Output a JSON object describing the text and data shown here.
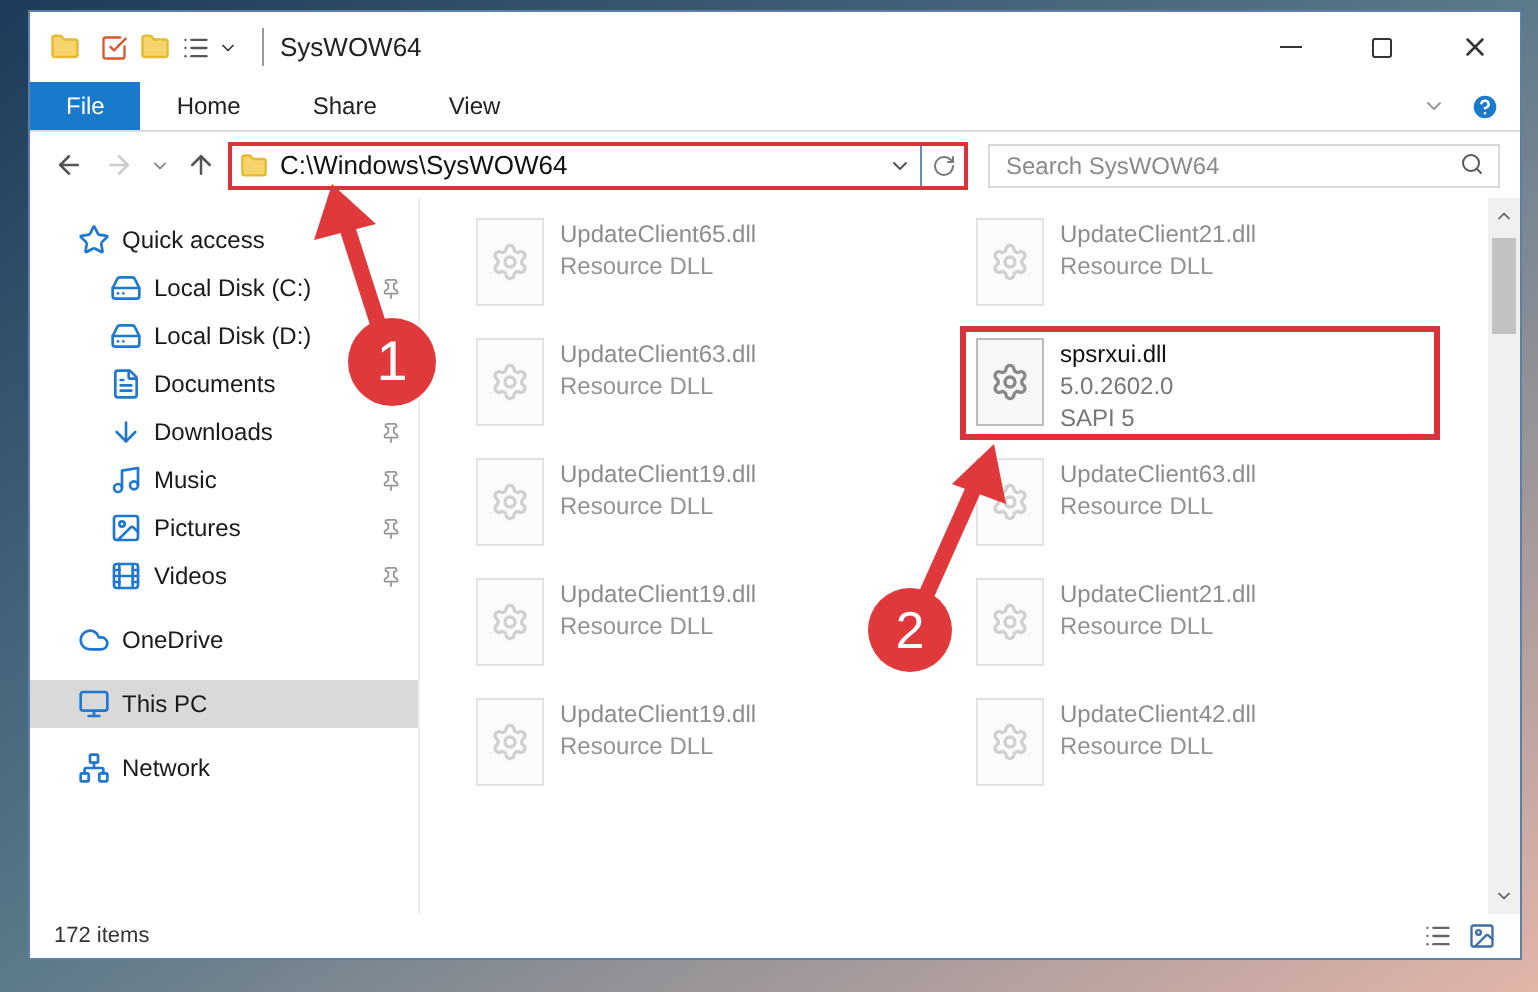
{
  "window": {
    "title": "SysWOW64"
  },
  "ribbon_tabs": [
    {
      "label": "File",
      "kind": "file",
      "selected": false
    },
    {
      "label": "Home",
      "kind": "tab",
      "selected": false
    },
    {
      "label": "Share",
      "kind": "tab",
      "selected": false
    },
    {
      "label": "View",
      "kind": "tab",
      "selected": false
    }
  ],
  "address": {
    "value": "C:\\Windows\\SysWOW64"
  },
  "search": {
    "placeholder": "Search SysWOW64"
  },
  "nav": [
    {
      "label": "Quick access",
      "selected": false,
      "children": [
        {
          "label": "Local Disk (C:)",
          "pinned": true,
          "selected": false
        },
        {
          "label": "Local Disk (D:)",
          "selected": false
        },
        {
          "label": "Documents",
          "selected": false
        },
        {
          "label": "Downloads",
          "pinned": true,
          "selected": false
        },
        {
          "label": "Music",
          "pinned": true,
          "selected": false
        },
        {
          "label": "Pictures",
          "pinned": true,
          "selected": false
        },
        {
          "label": "Videos",
          "pinned": true,
          "selected": false
        }
      ]
    },
    {
      "label": "OneDrive",
      "selected": false
    },
    {
      "label": "This PC",
      "selected": true
    },
    {
      "label": "Network",
      "selected": false
    }
  ],
  "files": [
    {
      "name": "UpdateClient65.dll",
      "lines": [
        "Resource DLL"
      ],
      "faded": true
    },
    {
      "name": "UpdateClient21.dll",
      "lines": [
        "Resource DLL"
      ],
      "faded": true
    },
    {
      "name": "UpdateClient63.dll",
      "lines": [
        "Resource DLL"
      ],
      "faded": true
    },
    {
      "name": "spsrxui.dll",
      "lines": [
        "5.0.2602.0",
        "SAPI 5"
      ],
      "faded": false
    },
    {
      "name": "UpdateClient19.dll",
      "lines": [
        "Resource DLL"
      ],
      "faded": true
    },
    {
      "name": "UpdateClient63.dll",
      "lines": [
        "Resource DLL"
      ],
      "faded": true
    },
    {
      "name": "UpdateClient19.dll",
      "lines": [
        "Resource DLL"
      ],
      "faded": true
    },
    {
      "name": "UpdateClient21.dll",
      "lines": [
        "Resource DLL"
      ],
      "faded": true
    },
    {
      "name": "UpdateClient19.dll",
      "lines": [
        "Resource DLL"
      ],
      "faded": true
    },
    {
      "name": "UpdateClient42.dll",
      "lines": [
        "Resource DLL"
      ],
      "faded": true
    }
  ],
  "status_bar": {
    "count": "172 items"
  },
  "annotations": [
    {
      "label": "1"
    },
    {
      "label": "2"
    }
  ]
}
